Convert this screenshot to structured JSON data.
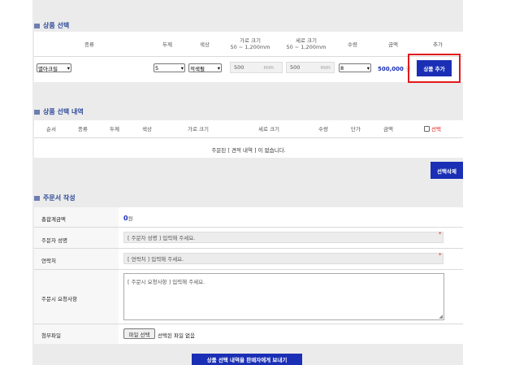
{
  "product_select": {
    "title": "상품 선택",
    "headers": {
      "type": "종류",
      "thickness": "두께",
      "color": "색상",
      "width": "가로 크기",
      "width_range": "50 ~ 1,200mm",
      "height": "세로 크기",
      "height_range": "50 ~ 1,200mm",
      "qty": "수량",
      "price": "금액",
      "add": "추가"
    },
    "type_value": "멸아크릴",
    "thickness_value": "5",
    "color_value": "적색펄",
    "width_value": "500",
    "width_unit": "mm",
    "height_value": "500",
    "height_unit": "mm",
    "qty_value": "8",
    "price_value": "500,000",
    "price_unit": "원",
    "add_button": "상품 추가"
  },
  "selection_list": {
    "title": "상품 선택 내역",
    "headers": [
      "순서",
      "종류",
      "두께",
      "색상",
      "가로 크기",
      "세로 크기",
      "수량",
      "단가",
      "금액"
    ],
    "select_label": "선택",
    "empty_message": "주문된 [ 견적 내역 ] 이 없습니다.",
    "delete_button": "선택삭제"
  },
  "order_form": {
    "title": "주문서 작성",
    "total_label": "총합계금액",
    "total_value": "0",
    "total_unit": "원",
    "name_label": "주문자 성명",
    "name_placeholder": "[ 주문자 성명 ] 입력해 주세요.",
    "contact_label": "연락처",
    "contact_placeholder": "[ 연락처 ] 입력해 주세요.",
    "request_label": "주문시 요청사항",
    "request_placeholder": "[ 주문시 요청사항 ] 입력해 주세요.",
    "attach_label": "첨부파일",
    "file_button": "파일 선택",
    "file_status": "선택된 파일 없음",
    "submit_button": "상품 선택 내역을 판매자에게 보내기"
  },
  "colors": {
    "accent_blue": "#1a2fb5",
    "title_blue": "#2f4a99",
    "highlight_red": "#e0191c"
  }
}
